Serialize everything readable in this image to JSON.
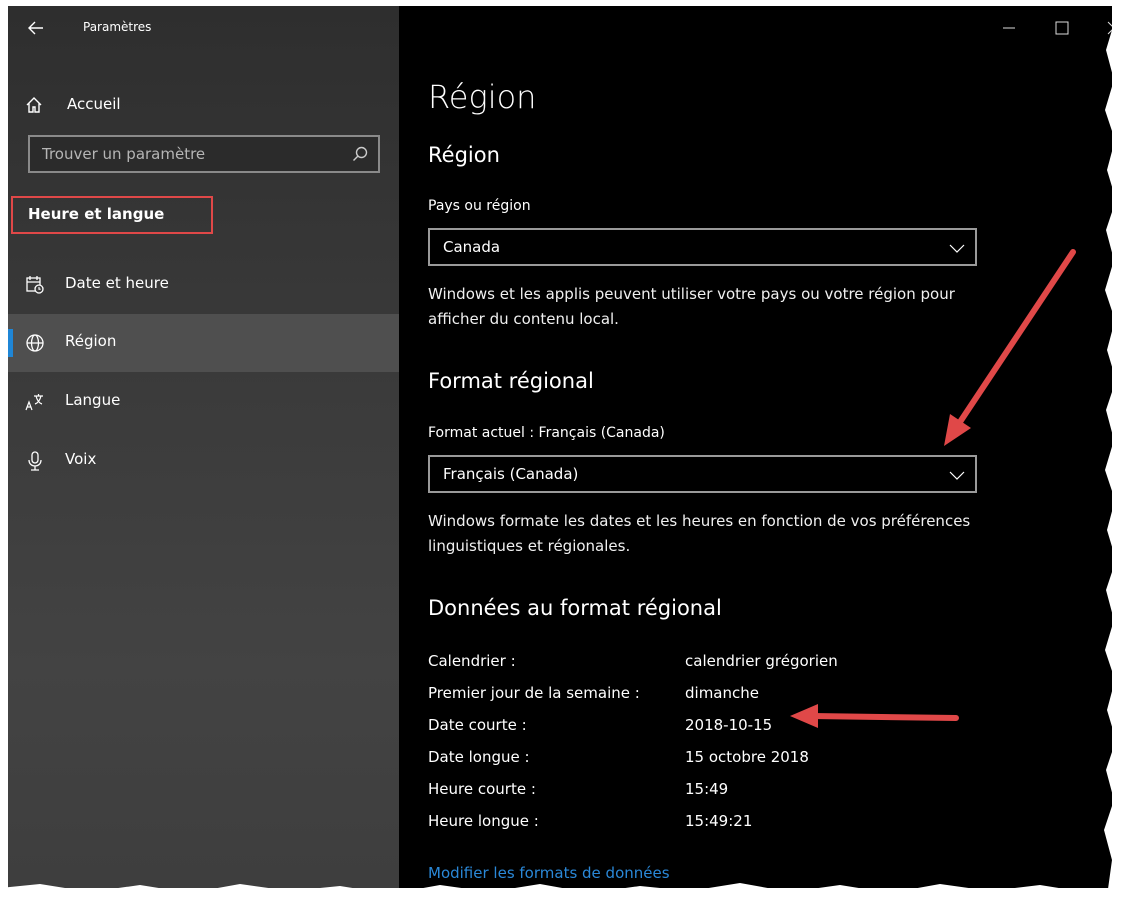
{
  "window": {
    "title": "Paramètres",
    "controls": [
      "minimize-icon",
      "maximize-icon",
      "close-icon"
    ]
  },
  "sidebar": {
    "back_icon": "back-arrow-icon",
    "home": {
      "label": "Accueil",
      "icon": "home-icon"
    },
    "search": {
      "placeholder": "Trouver un paramètre",
      "icon": "search-icon"
    },
    "section_title": "Heure et langue",
    "items": [
      {
        "label": "Date et heure",
        "icon": "calendar-clock-icon",
        "active": false
      },
      {
        "label": "Région",
        "icon": "globe-icon",
        "active": true
      },
      {
        "label": "Langue",
        "icon": "language-icon",
        "active": false
      },
      {
        "label": "Voix",
        "icon": "microphone-icon",
        "active": false
      }
    ]
  },
  "main": {
    "page_title": "Région",
    "region": {
      "heading": "Région",
      "label": "Pays ou région",
      "value": "Canada",
      "description": "Windows et les applis peuvent utiliser votre pays ou votre région pour afficher du contenu local."
    },
    "format": {
      "heading": "Format régional",
      "label": "Format actuel : Français (Canada)",
      "value": "Français (Canada)",
      "description": "Windows formate les dates et les heures en fonction de vos préférences linguistiques et régionales."
    },
    "data": {
      "heading": "Données au format régional",
      "rows": [
        {
          "key": "Calendrier :",
          "value": "calendrier grégorien"
        },
        {
          "key": "Premier jour de la semaine :",
          "value": "dimanche"
        },
        {
          "key": "Date courte :",
          "value": "2018-10-15"
        },
        {
          "key": "Date longue :",
          "value": "15 octobre 2018"
        },
        {
          "key": "Heure courte :",
          "value": "15:49"
        },
        {
          "key": "Heure longue :",
          "value": "15:49:21"
        }
      ],
      "link": "Modifier les formats de données"
    }
  },
  "colors": {
    "accent": "#1f86d6",
    "link": "#2a88d8",
    "annotation": "#e04848",
    "background": "#000000"
  }
}
